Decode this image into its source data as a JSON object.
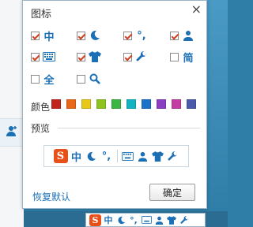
{
  "dialog": {
    "title": "图标",
    "close_glyph": "×",
    "icon_options": [
      {
        "row": 0,
        "col": 0,
        "checked": true,
        "icon": "zh-char-icon",
        "glyph": "中"
      },
      {
        "row": 0,
        "col": 1,
        "checked": true,
        "icon": "moon-icon"
      },
      {
        "row": 0,
        "col": 2,
        "checked": true,
        "icon": "punctuation-icon",
        "glyph": "°,"
      },
      {
        "row": 0,
        "col": 3,
        "checked": true,
        "icon": "user-icon"
      },
      {
        "row": 1,
        "col": 0,
        "checked": true,
        "icon": "keyboard-icon"
      },
      {
        "row": 1,
        "col": 1,
        "checked": true,
        "icon": "shirt-icon"
      },
      {
        "row": 1,
        "col": 2,
        "checked": true,
        "icon": "wrench-icon"
      },
      {
        "row": 1,
        "col": 3,
        "checked": false,
        "icon": "simplified-char-icon",
        "glyph": "简"
      },
      {
        "row": 2,
        "col": 0,
        "checked": false,
        "icon": "fullwidth-char-icon",
        "glyph": "全"
      },
      {
        "row": 2,
        "col": 1,
        "checked": false,
        "icon": "search-icon"
      }
    ],
    "color_label": "颜色",
    "colors": [
      "#c0241c",
      "#e8661a",
      "#e6c71a",
      "#8ec21f",
      "#3cb544",
      "#12b3c1",
      "#1b72c8",
      "#8b3fc1",
      "#c23ea3",
      "#4a5aa8"
    ],
    "preview_label": "预览",
    "preview_logo": "S",
    "restore_label": "恢复默认",
    "ok_label": "确定"
  },
  "taskbar": {
    "logo": "S",
    "zh_glyph": "中",
    "punct_glyph": "°,"
  }
}
